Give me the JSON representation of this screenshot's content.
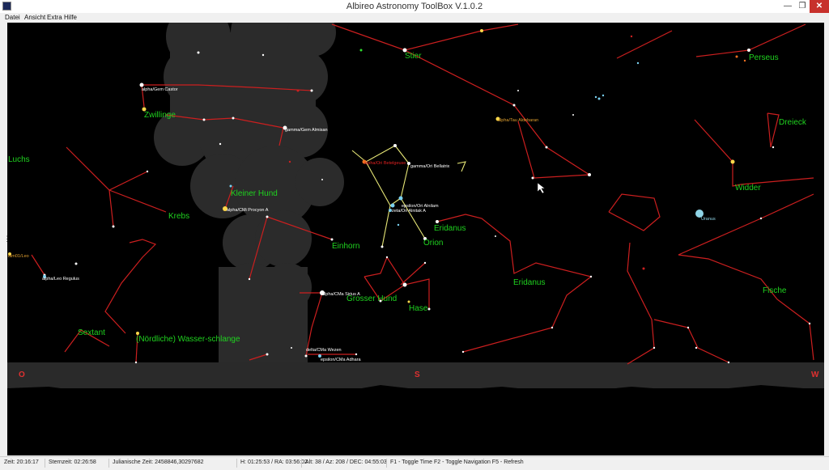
{
  "window": {
    "title": "Albireo Astronomy ToolBox V.1.0.2",
    "btn_minimize": "—",
    "btn_maximize": "❐",
    "btn_close": "✕"
  },
  "menu": [
    {
      "label": "Datei"
    },
    {
      "label": "Ansicht"
    },
    {
      "label": "Extra"
    },
    {
      "label": "Hilfe"
    }
  ],
  "horizon": {
    "o": "O",
    "s": "S",
    "w": "W"
  },
  "constellations": {
    "stier": "Stier",
    "perseus": "Perseus",
    "zwillinge": "Zwillinge",
    "dreieck": "Dreieck",
    "luchs": "Luchs",
    "widder": "Widder",
    "kleiner_hund": "Kleiner Hund",
    "krebs": "Krebs",
    "eridanus1": "Eridanus",
    "einhorn": "Einhorn",
    "orion": "Orion",
    "eridanus2": "Eridanus",
    "fische": "Fische",
    "grosser_hund": "Grosser Hund",
    "hase": "Hase",
    "sextant": "Sextant",
    "wasserschlange": "(Nördliche) Wasser-schlange"
  },
  "stars": {
    "castor": "alpha/Gem Castor",
    "almisan": "gamma/Gem Almisan",
    "aldebaran": "alpha/Tau Aldebaran",
    "betelgeuse": "alpha/Ori Betelgeuse",
    "bellatrix": "gamma/Ori Bellatrix",
    "alnilam": "epsilon/Ori Alnilam",
    "alnitak": "zeta/Ori Alnitak A",
    "procyon": "alpha/CMi Procyon A",
    "lam01": "lam01/Leo",
    "regulus": "alpha/Leo Regulus",
    "sirius": "alpha/CMa Sirius A",
    "wezen": "delta/CMa Wezen",
    "adhara": "epsilon/CMa Adhara",
    "uranus": "Uranus"
  },
  "colors": {
    "sky": "#000000",
    "milkyway": "#2a2a2a",
    "constellation_line": "#cc1f1f",
    "orion_line": "#e6e676",
    "label_green": "#1fd31f",
    "horizon": "#2a2a2a"
  },
  "status": {
    "zeit": "Zeit: 20:16:17",
    "sternzeit": "Sternzeit: 02:26:58",
    "julian": "Julianische Zeit: 2458846,30297682",
    "ha_ra": "H: 01:25:53 / RA: 03:56:02",
    "alt_az_dec": "Alt: 38 / Az: 208 / DEC: 04:55:03",
    "shortcuts": "F1 - Toggle Time   F2 - Toggle Navigation   F5 - Refresh"
  }
}
